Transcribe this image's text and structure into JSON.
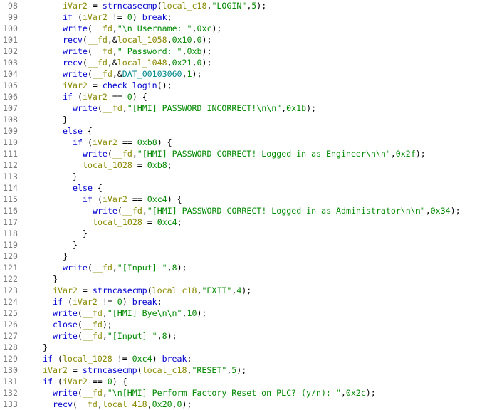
{
  "view": "decompiler-listing",
  "colors": {
    "keyword": "#0000d0",
    "function": "#0000d0",
    "variable": "#8a8a00",
    "string": "#008a00",
    "number": "#008a00",
    "global": "#008a8a",
    "punct": "#000000",
    "line_number": "#7a7a7a"
  },
  "lines": [
    {
      "n": "98",
      "indent": 8,
      "tokens": [
        [
          "var",
          "iVar2"
        ],
        [
          "p",
          " = "
        ],
        [
          "fn",
          "strncasecmp"
        ],
        [
          "p",
          "("
        ],
        [
          "var",
          "local_c18"
        ],
        [
          "p",
          ","
        ],
        [
          "str",
          "\"LOGIN\""
        ],
        [
          "p",
          ","
        ],
        [
          "num",
          "5"
        ],
        [
          "p",
          ");"
        ]
      ]
    },
    {
      "n": "99",
      "indent": 8,
      "tokens": [
        [
          "kw",
          "if"
        ],
        [
          "p",
          " ("
        ],
        [
          "var",
          "iVar2"
        ],
        [
          "p",
          " != "
        ],
        [
          "num",
          "0"
        ],
        [
          "p",
          ") "
        ],
        [
          "kw",
          "break"
        ],
        [
          "p",
          ";"
        ]
      ]
    },
    {
      "n": "100",
      "indent": 8,
      "tokens": [
        [
          "fn",
          "write"
        ],
        [
          "p",
          "("
        ],
        [
          "var",
          "__fd"
        ],
        [
          "p",
          ","
        ],
        [
          "str",
          "\"\\n Username: \""
        ],
        [
          "p",
          ","
        ],
        [
          "num",
          "0xc"
        ],
        [
          "p",
          ");"
        ]
      ]
    },
    {
      "n": "101",
      "indent": 8,
      "tokens": [
        [
          "fn",
          "recv"
        ],
        [
          "p",
          "("
        ],
        [
          "var",
          "__fd"
        ],
        [
          "p",
          ",&"
        ],
        [
          "var",
          "local_1058"
        ],
        [
          "p",
          ","
        ],
        [
          "num",
          "0x10"
        ],
        [
          "p",
          ","
        ],
        [
          "num",
          "0"
        ],
        [
          "p",
          ");"
        ]
      ]
    },
    {
      "n": "102",
      "indent": 8,
      "tokens": [
        [
          "fn",
          "write"
        ],
        [
          "p",
          "("
        ],
        [
          "var",
          "__fd"
        ],
        [
          "p",
          ","
        ],
        [
          "str",
          "\" Password: \""
        ],
        [
          "p",
          ","
        ],
        [
          "num",
          "0xb"
        ],
        [
          "p",
          ");"
        ]
      ]
    },
    {
      "n": "103",
      "indent": 8,
      "tokens": [
        [
          "fn",
          "recv"
        ],
        [
          "p",
          "("
        ],
        [
          "var",
          "__fd"
        ],
        [
          "p",
          ",&"
        ],
        [
          "var",
          "local_1048"
        ],
        [
          "p",
          ","
        ],
        [
          "num",
          "0x21"
        ],
        [
          "p",
          ","
        ],
        [
          "num",
          "0"
        ],
        [
          "p",
          ");"
        ]
      ]
    },
    {
      "n": "104",
      "indent": 8,
      "tokens": [
        [
          "fn",
          "write"
        ],
        [
          "p",
          "("
        ],
        [
          "var",
          "__fd"
        ],
        [
          "p",
          ",&"
        ],
        [
          "glob",
          "DAT_00103060"
        ],
        [
          "p",
          ","
        ],
        [
          "num",
          "1"
        ],
        [
          "p",
          ");"
        ]
      ]
    },
    {
      "n": "105",
      "indent": 8,
      "tokens": [
        [
          "var",
          "iVar2"
        ],
        [
          "p",
          " = "
        ],
        [
          "fn",
          "check_login"
        ],
        [
          "p",
          "();"
        ]
      ]
    },
    {
      "n": "106",
      "indent": 8,
      "tokens": [
        [
          "kw",
          "if"
        ],
        [
          "p",
          " ("
        ],
        [
          "var",
          "iVar2"
        ],
        [
          "p",
          " == "
        ],
        [
          "num",
          "0"
        ],
        [
          "p",
          ") {"
        ]
      ]
    },
    {
      "n": "107",
      "indent": 10,
      "tokens": [
        [
          "fn",
          "write"
        ],
        [
          "p",
          "("
        ],
        [
          "var",
          "__fd"
        ],
        [
          "p",
          ","
        ],
        [
          "str",
          "\"[HMI] PASSWORD INCORRECT!\\n\\n\""
        ],
        [
          "p",
          ","
        ],
        [
          "num",
          "0x1b"
        ],
        [
          "p",
          ");"
        ]
      ]
    },
    {
      "n": "108",
      "indent": 8,
      "tokens": [
        [
          "p",
          "}"
        ]
      ]
    },
    {
      "n": "109",
      "indent": 8,
      "tokens": [
        [
          "kw",
          "else"
        ],
        [
          "p",
          " {"
        ]
      ]
    },
    {
      "n": "110",
      "indent": 10,
      "tokens": [
        [
          "kw",
          "if"
        ],
        [
          "p",
          " ("
        ],
        [
          "var",
          "iVar2"
        ],
        [
          "p",
          " == "
        ],
        [
          "num",
          "0xb8"
        ],
        [
          "p",
          ") {"
        ]
      ]
    },
    {
      "n": "111",
      "indent": 12,
      "tokens": [
        [
          "fn",
          "write"
        ],
        [
          "p",
          "("
        ],
        [
          "var",
          "__fd"
        ],
        [
          "p",
          ","
        ],
        [
          "str",
          "\"[HMI] PASSWORD CORRECT! Logged in as Engineer\\n\\n\""
        ],
        [
          "p",
          ","
        ],
        [
          "num",
          "0x2f"
        ],
        [
          "p",
          ");"
        ]
      ]
    },
    {
      "n": "112",
      "indent": 12,
      "tokens": [
        [
          "var",
          "local_1028"
        ],
        [
          "p",
          " = "
        ],
        [
          "num",
          "0xb8"
        ],
        [
          "p",
          ";"
        ]
      ]
    },
    {
      "n": "113",
      "indent": 10,
      "tokens": [
        [
          "p",
          "}"
        ]
      ]
    },
    {
      "n": "114",
      "indent": 10,
      "tokens": [
        [
          "kw",
          "else"
        ],
        [
          "p",
          " {"
        ]
      ]
    },
    {
      "n": "115",
      "indent": 12,
      "tokens": [
        [
          "kw",
          "if"
        ],
        [
          "p",
          " ("
        ],
        [
          "var",
          "iVar2"
        ],
        [
          "p",
          " == "
        ],
        [
          "num",
          "0xc4"
        ],
        [
          "p",
          ") {"
        ]
      ]
    },
    {
      "n": "116",
      "indent": 14,
      "tokens": [
        [
          "fn",
          "write"
        ],
        [
          "p",
          "("
        ],
        [
          "var",
          "__fd"
        ],
        [
          "p",
          ","
        ],
        [
          "str",
          "\"[HMI] PASSWORD CORRECT! Logged in as Administrator\\n\\n\""
        ],
        [
          "p",
          ","
        ],
        [
          "num",
          "0x34"
        ],
        [
          "p",
          ");"
        ]
      ]
    },
    {
      "n": "117",
      "indent": 14,
      "tokens": [
        [
          "var",
          "local_1028"
        ],
        [
          "p",
          " = "
        ],
        [
          "num",
          "0xc4"
        ],
        [
          "p",
          ";"
        ]
      ]
    },
    {
      "n": "118",
      "indent": 12,
      "tokens": [
        [
          "p",
          "}"
        ]
      ]
    },
    {
      "n": "119",
      "indent": 10,
      "tokens": [
        [
          "p",
          "}"
        ]
      ]
    },
    {
      "n": "120",
      "indent": 8,
      "tokens": [
        [
          "p",
          "}"
        ]
      ]
    },
    {
      "n": "121",
      "indent": 8,
      "tokens": [
        [
          "fn",
          "write"
        ],
        [
          "p",
          "("
        ],
        [
          "var",
          "__fd"
        ],
        [
          "p",
          ","
        ],
        [
          "str",
          "\"[Input] \""
        ],
        [
          "p",
          ","
        ],
        [
          "num",
          "8"
        ],
        [
          "p",
          ");"
        ]
      ]
    },
    {
      "n": "122",
      "indent": 6,
      "tokens": [
        [
          "p",
          "}"
        ]
      ]
    },
    {
      "n": "123",
      "indent": 6,
      "tokens": [
        [
          "var",
          "iVar2"
        ],
        [
          "p",
          " = "
        ],
        [
          "fn",
          "strncasecmp"
        ],
        [
          "p",
          "("
        ],
        [
          "var",
          "local_c18"
        ],
        [
          "p",
          ","
        ],
        [
          "str",
          "\"EXIT\""
        ],
        [
          "p",
          ","
        ],
        [
          "num",
          "4"
        ],
        [
          "p",
          ");"
        ]
      ]
    },
    {
      "n": "124",
      "indent": 6,
      "tokens": [
        [
          "kw",
          "if"
        ],
        [
          "p",
          " ("
        ],
        [
          "var",
          "iVar2"
        ],
        [
          "p",
          " != "
        ],
        [
          "num",
          "0"
        ],
        [
          "p",
          ") "
        ],
        [
          "kw",
          "break"
        ],
        [
          "p",
          ";"
        ]
      ]
    },
    {
      "n": "125",
      "indent": 6,
      "tokens": [
        [
          "fn",
          "write"
        ],
        [
          "p",
          "("
        ],
        [
          "var",
          "__fd"
        ],
        [
          "p",
          ","
        ],
        [
          "str",
          "\"[HMI] Bye\\n\\n\""
        ],
        [
          "p",
          ","
        ],
        [
          "num",
          "10"
        ],
        [
          "p",
          ");"
        ]
      ]
    },
    {
      "n": "126",
      "indent": 6,
      "tokens": [
        [
          "fn",
          "close"
        ],
        [
          "p",
          "("
        ],
        [
          "var",
          "__fd"
        ],
        [
          "p",
          ");"
        ]
      ]
    },
    {
      "n": "127",
      "indent": 6,
      "tokens": [
        [
          "fn",
          "write"
        ],
        [
          "p",
          "("
        ],
        [
          "var",
          "__fd"
        ],
        [
          "p",
          ","
        ],
        [
          "str",
          "\"[Input] \""
        ],
        [
          "p",
          ","
        ],
        [
          "num",
          "8"
        ],
        [
          "p",
          ");"
        ]
      ]
    },
    {
      "n": "128",
      "indent": 4,
      "tokens": [
        [
          "p",
          "}"
        ]
      ]
    },
    {
      "n": "129",
      "indent": 4,
      "tokens": [
        [
          "kw",
          "if"
        ],
        [
          "p",
          " ("
        ],
        [
          "var",
          "local_1028"
        ],
        [
          "p",
          " != "
        ],
        [
          "num",
          "0xc4"
        ],
        [
          "p",
          ") "
        ],
        [
          "kw",
          "break"
        ],
        [
          "p",
          ";"
        ]
      ]
    },
    {
      "n": "130",
      "indent": 4,
      "tokens": [
        [
          "var",
          "iVar2"
        ],
        [
          "p",
          " = "
        ],
        [
          "fn",
          "strncasecmp"
        ],
        [
          "p",
          "("
        ],
        [
          "var",
          "local_c18"
        ],
        [
          "p",
          ","
        ],
        [
          "str",
          "\"RESET\""
        ],
        [
          "p",
          ","
        ],
        [
          "num",
          "5"
        ],
        [
          "p",
          ");"
        ]
      ]
    },
    {
      "n": "131",
      "indent": 4,
      "tokens": [
        [
          "kw",
          "if"
        ],
        [
          "p",
          " ("
        ],
        [
          "var",
          "iVar2"
        ],
        [
          "p",
          " == "
        ],
        [
          "num",
          "0"
        ],
        [
          "p",
          ") {"
        ]
      ]
    },
    {
      "n": "132",
      "indent": 6,
      "tokens": [
        [
          "fn",
          "write"
        ],
        [
          "p",
          "("
        ],
        [
          "var",
          "__fd"
        ],
        [
          "p",
          ","
        ],
        [
          "str",
          "\"\\n[HMI] Perform Factory Reset on PLC? (y/n): \""
        ],
        [
          "p",
          ","
        ],
        [
          "num",
          "0x2c"
        ],
        [
          "p",
          ");"
        ]
      ]
    },
    {
      "n": "133",
      "indent": 6,
      "tokens": [
        [
          "fn",
          "recv"
        ],
        [
          "p",
          "("
        ],
        [
          "var",
          "__fd"
        ],
        [
          "p",
          ","
        ],
        [
          "var",
          "local_418"
        ],
        [
          "p",
          ","
        ],
        [
          "num",
          "0x20"
        ],
        [
          "p",
          ","
        ],
        [
          "num",
          "0"
        ],
        [
          "p",
          ");"
        ]
      ]
    }
  ]
}
